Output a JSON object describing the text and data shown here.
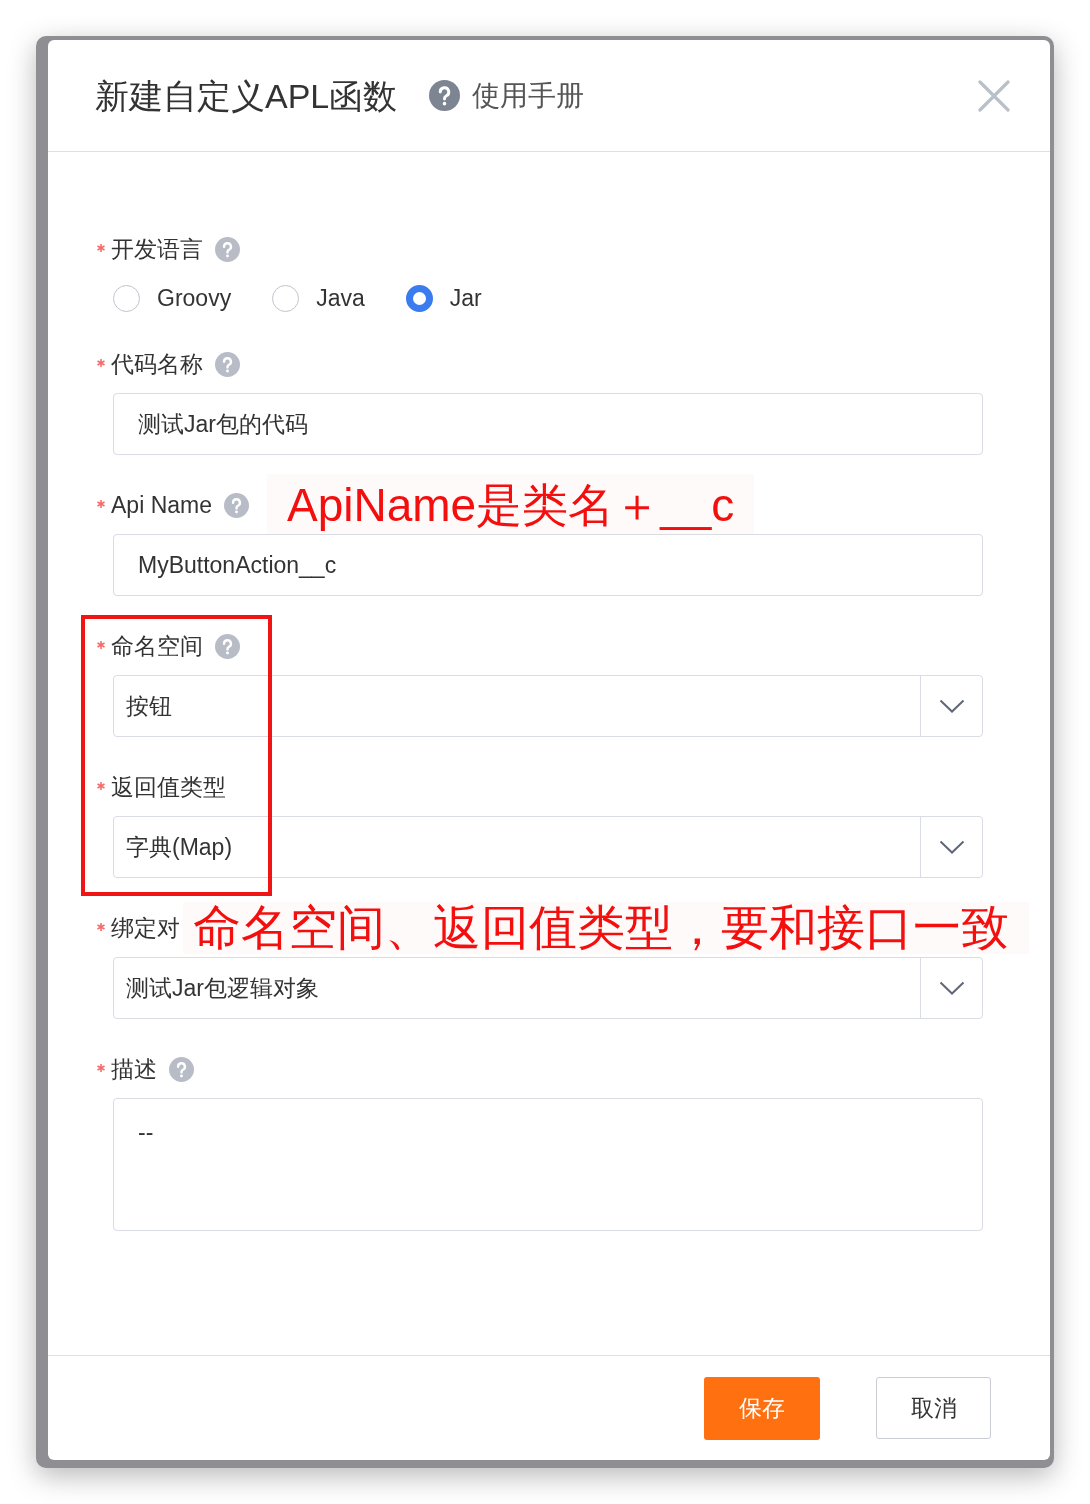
{
  "dialog": {
    "title": "新建自定义APL函数",
    "help_link": "使用手册"
  },
  "fields": [
    {
      "kind": "radio",
      "label": "开发语言",
      "required": true,
      "help": true,
      "highlight": false,
      "options": [
        {
          "label": "Groovy",
          "selected": false
        },
        {
          "label": "Java",
          "selected": false
        },
        {
          "label": "Jar",
          "selected": true
        }
      ]
    },
    {
      "kind": "text",
      "label": "代码名称",
      "required": true,
      "help": true,
      "highlight": false,
      "value": "测试Jar包的代码"
    },
    {
      "kind": "text",
      "label": "Api Name",
      "required": true,
      "help": true,
      "highlight": false,
      "value": "MyButtonAction__c",
      "annotation": "ApiName是类名＋__c"
    },
    {
      "kind": "select",
      "label": "命名空间",
      "required": true,
      "help": true,
      "highlight": true,
      "value": "按钮"
    },
    {
      "kind": "select",
      "label": "返回值类型",
      "required": true,
      "help": false,
      "highlight": true,
      "value": "字典(Map)"
    },
    {
      "kind": "select",
      "label": "绑定对",
      "required": true,
      "help": false,
      "highlight": false,
      "value": "测试Jar包逻辑对象",
      "annotation": "命名空间、返回值类型，要和接口一致"
    },
    {
      "kind": "textarea",
      "label": "描述",
      "required": true,
      "help": true,
      "highlight": false,
      "value": "--"
    }
  ],
  "buttons": [
    {
      "label": "保存",
      "kind": "primary"
    },
    {
      "label": "取消",
      "kind": "default"
    }
  ]
}
